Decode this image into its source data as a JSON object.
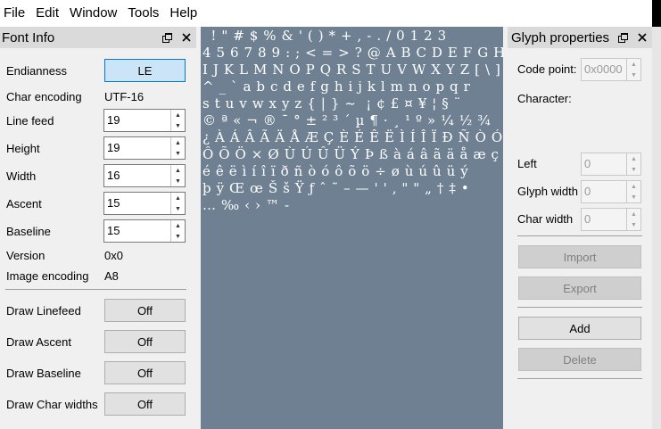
{
  "menubar": {
    "items": [
      "File",
      "Edit",
      "Window",
      "Tools",
      "Help"
    ]
  },
  "font_info": {
    "title": "Font Info",
    "float_icon": "float-icon",
    "close_icon": "close-icon",
    "endianness_label": "Endianness",
    "endianness_value": "LE",
    "char_encoding_label": "Char encoding",
    "char_encoding_value": "UTF-16",
    "line_feed_label": "Line feed",
    "line_feed_value": "19",
    "height_label": "Height",
    "height_value": "19",
    "width_label": "Width",
    "width_value": "16",
    "ascent_label": "Ascent",
    "ascent_value": "15",
    "baseline_label": "Baseline",
    "baseline_value": "15",
    "version_label": "Version",
    "version_value": "0x0",
    "image_encoding_label": "Image encoding",
    "image_encoding_value": "A8",
    "draw_linefeed_label": "Draw Linefeed",
    "draw_linefeed_value": "Off",
    "draw_ascent_label": "Draw Ascent",
    "draw_ascent_value": "Off",
    "draw_baseline_label": "Draw Baseline",
    "draw_baseline_value": "Off",
    "draw_char_widths_label": "Draw Char widths",
    "draw_char_widths_value": "Off"
  },
  "glyph_grid": {
    "lines": [
      " ! \" # $ % & ' ( ) * + , - . / 0 1 2 3",
      "4 5 6 7 8 9 : ; < = > ? @ A B C D E F G H",
      "I J K L M N O P Q R S T U V W X Y Z [ \\ ]",
      "^ _ ` a b c d e f g h i j k l m n o p q r",
      "s t u v w x y z { | } ~  ¡ ¢ £ ¤ ¥ ¦ § ¨",
      "© ª « ¬ ® ¯ ° ± ² ³ ´ µ ¶ · ¸ ¹ º » ¼ ½ ¾",
      "¿ À Á Â Ã Ä Å Æ Ç È É Ê Ë Ì Í Î Ï Ð Ñ Ò Ó",
      "Ô Õ Ö × Ø Ù Ú Û Ü Ý Þ ß à á â ã ä å æ ç è",
      "é ê ë ì í î ï ð ñ ò ó ô õ ö ÷ ø ù ú û ü ý",
      "þ ÿ Œ œ Š š Ÿ ƒ ˆ ˜ – — ' ' ‚ \" \" „ † ‡ •",
      "… ‰ ‹ › ™ -"
    ]
  },
  "glyph_properties": {
    "title": "Glyph properties",
    "float_icon": "float-icon",
    "close_icon": "close-icon",
    "code_point_label": "Code point:",
    "code_point_value": "0x0000",
    "character_label": "Character:",
    "left_label": "Left",
    "left_value": "0",
    "glyph_width_label": "Glyph width",
    "glyph_width_value": "0",
    "char_width_label": "Char width",
    "char_width_value": "0",
    "import_label": "Import",
    "export_label": "Export",
    "add_label": "Add",
    "delete_label": "Delete"
  }
}
